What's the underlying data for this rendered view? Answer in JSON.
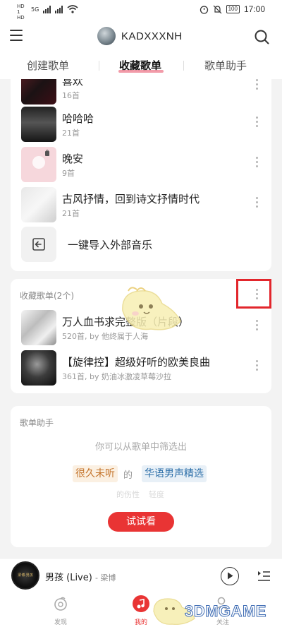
{
  "status_bar": {
    "sim1": "HD 1",
    "sim2": "HD 2",
    "network": "5G",
    "battery": "100",
    "time": "17:00"
  },
  "header": {
    "username": "KADXXXNH"
  },
  "tabs": [
    {
      "label": "创建歌单"
    },
    {
      "label": "收藏歌单"
    },
    {
      "label": "歌单助手"
    }
  ],
  "created_playlists": [
    {
      "title": "喜欢",
      "count": "16首"
    },
    {
      "title": "哈哈哈",
      "count": "21首"
    },
    {
      "title": "晚安",
      "count": "9首"
    },
    {
      "title": "古风抒情，回到诗文抒情时代",
      "count": "21首"
    }
  ],
  "import_label": "一键导入外部音乐",
  "collected": {
    "section_label": "收藏歌单(2个)",
    "items": [
      {
        "title": "万人血书求完整版（片段）",
        "subtitle": "520首, by 他终属于人海"
      },
      {
        "title": "【旋律控】超级好听的欧美良曲",
        "subtitle": "361首, by 奶油冰激凌草莓沙拉"
      }
    ]
  },
  "helper": {
    "section_label": "歌单助手",
    "hint": "你可以从歌单中筛选出",
    "tag_a": "很久未听",
    "of": "的",
    "tag_b": "华语男声精选",
    "faded_a": "的伤性",
    "faded_b": "轻度",
    "try_button": "试试看"
  },
  "mini_player": {
    "song": "男孩 (Live)",
    "artist": "- 梁博",
    "cover_text": "梁博·男孩"
  },
  "bottom_nav": [
    {
      "label": "发现"
    },
    {
      "label": "我的"
    },
    {
      "label": "关注"
    }
  ],
  "watermark": "3DMGAME",
  "colors": {
    "accent": "#e93434",
    "highlight_box": "#e2262c",
    "tab_underline": "#f08a9a"
  }
}
